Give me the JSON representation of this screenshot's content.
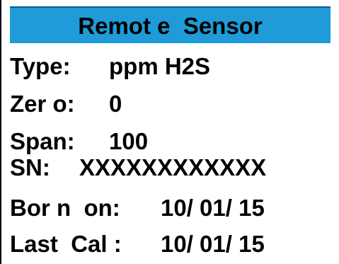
{
  "header": {
    "title": "Remot e  Sensor"
  },
  "fields": {
    "type": {
      "label": "Type:",
      "value": "ppm H2S"
    },
    "zero": {
      "label": "Zer o:",
      "value": "0"
    },
    "span": {
      "label": "Span:",
      "value": "100"
    },
    "serial": {
      "label": "SN:",
      "value": "XXXXXXXXXXXX"
    },
    "born_on": {
      "label": "Bor n  on:",
      "value": "10/ 01/ 15"
    },
    "last_cal": {
      "label": "Last  Cal :",
      "value": "10/ 01/ 15"
    }
  },
  "colors": {
    "title_bar": "#1e9bd8",
    "text": "#000000",
    "background": "#ffffff"
  }
}
